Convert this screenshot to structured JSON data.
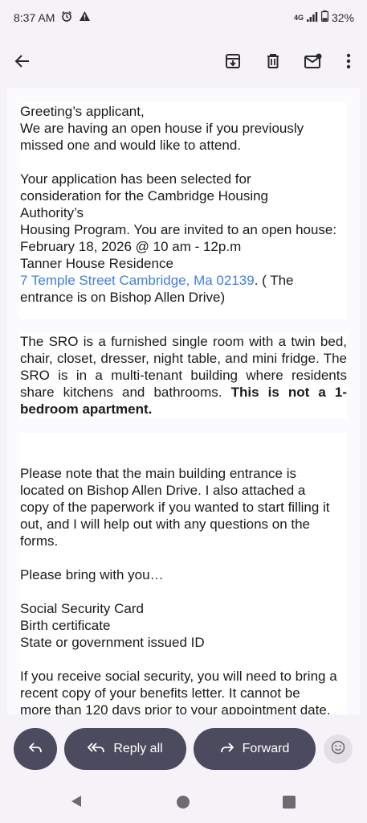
{
  "status_bar": {
    "time": "8:37 AM",
    "network": "4G",
    "battery": "32%"
  },
  "app_bar": {
    "icons": [
      "back-arrow-icon",
      "archive-icon",
      "delete-icon",
      "mark-unread-icon",
      "more-vert-icon"
    ]
  },
  "email": {
    "block1": {
      "line1": "Greeting’s applicant,",
      "line2": "We are having an open house if you previously",
      "line3": "missed one and would like to attend.",
      "line4": "Your application has been selected for",
      "line5": "consideration for the Cambridge Housing",
      "line6": "Authority’s",
      "line7": "Housing Program. You are invited to an open house:",
      "line8": "February 18, 2026 @ 10 am - 12p.m",
      "line9": "Tanner House Residence",
      "address_link": "7 Temple Street Cambridge, Ma 02139",
      "address_tail": ". ( The",
      "line11": "entrance is on Bishop Allen Drive)"
    },
    "block2": {
      "text": "The SRO is a furnished single room with a twin bed, chair, closet, dresser, night table, and mini fridge. The SRO is in a multi-tenant building where residents share kitchens and bathrooms.",
      "bold": "This is not a 1-bedroom apartment."
    },
    "block3": {
      "p1_l1": "Please note that the main building entrance is",
      "p1_l2": "located on Bishop Allen Drive. I also attached a",
      "p1_l3": "copy of the paperwork if you wanted to start filling it",
      "p1_l4": "out, and I will help out with any questions on the",
      "p1_l5": "forms.",
      "p2": "Please bring with you…",
      "item1": "Social Security Card",
      "item2": "Birth certificate",
      "item3": "State or government issued ID",
      "p3_l1": "If you receive social security, you will need to bring a",
      "p3_l2": "recent copy of your benefits letter. It cannot be",
      "p3_l3": "more than 120 days prior to your appointment date."
    }
  },
  "actions": {
    "reply_all": "Reply all",
    "forward": "Forward"
  },
  "colors": {
    "pill": "#4c4a5e",
    "link": "#3f7ee0",
    "background": "#f6f3f8"
  }
}
